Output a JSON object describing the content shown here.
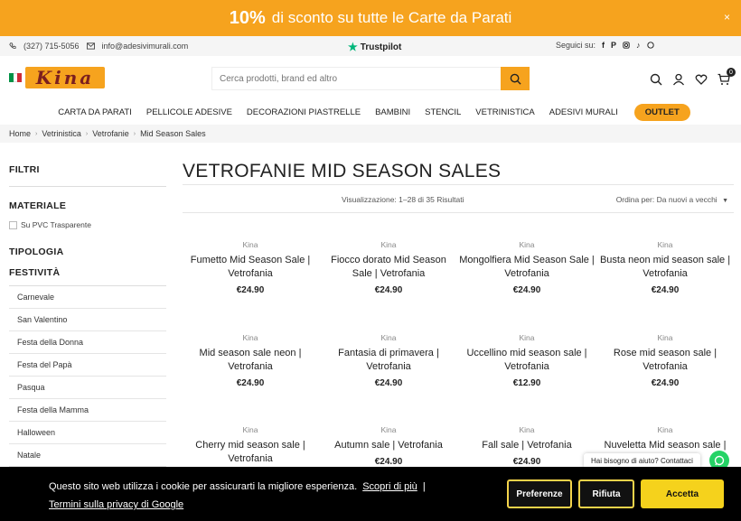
{
  "promo": {
    "percent": "10%",
    "text": "di sconto su tutte le Carte da Parati",
    "close": "×"
  },
  "topbar": {
    "phone": "(327) 715-5056",
    "email": "info@adesivimurali.com",
    "trustpilot": "Trustpilot",
    "social_label": "Seguici su:",
    "social_icons": [
      "facebook-icon",
      "pinterest-icon",
      "instagram-icon",
      "tiktok-icon",
      "whatsapp-icon"
    ]
  },
  "logo": {
    "text": "Kina"
  },
  "search": {
    "placeholder": "Cerca prodotti, brand ed altro"
  },
  "cart": {
    "count": "0"
  },
  "nav": [
    "CARTA DA PARATI",
    "PELLICOLE ADESIVE",
    "DECORAZIONI PIASTRELLE",
    "BAMBINI",
    "STENCIL",
    "VETRINISTICA",
    "ADESIVI MURALI"
  ],
  "nav_outlet": "OUTLET",
  "breadcrumb": [
    "Home",
    "Vetrinistica",
    "Vetrofanie",
    "Mid Season Sales"
  ],
  "sidebar": {
    "filters": "FILTRI",
    "materiale": "MATERIALE",
    "materiale_option": "Su PVC Trasparente",
    "tipologia": "TIPOLOGIA",
    "festivita": "FESTIVITÀ",
    "festivita_items": [
      "Carnevale",
      "San Valentino",
      "Festa della Donna",
      "Festa del Papà",
      "Pasqua",
      "Festa della Mamma",
      "Halloween",
      "Natale"
    ]
  },
  "main": {
    "title": "VETROFANIE MID SEASON SALES",
    "results": "Visualizzazione: 1–28 di 35 Risultati",
    "order_label": "Ordina per:",
    "order_value": "Da nuovi a vecchi"
  },
  "products": [
    {
      "brand": "Kina",
      "name": "Fumetto Mid Season Sale | Vetrofania",
      "price": "€24.90"
    },
    {
      "brand": "Kina",
      "name": "Fiocco dorato Mid Season Sale | Vetrofania",
      "price": "€24.90"
    },
    {
      "brand": "Kina",
      "name": "Mongolfiera Mid Season Sale | Vetrofania",
      "price": "€24.90"
    },
    {
      "brand": "Kina",
      "name": "Busta neon mid season sale | Vetrofania",
      "price": "€24.90"
    },
    {
      "brand": "Kina",
      "name": "Mid season sale neon | Vetrofania",
      "price": "€24.90"
    },
    {
      "brand": "Kina",
      "name": "Fantasia di primavera | Vetrofania",
      "price": "€24.90"
    },
    {
      "brand": "Kina",
      "name": "Uccellino mid season sale | Vetrofania",
      "price": "€12.90"
    },
    {
      "brand": "Kina",
      "name": "Rose mid season sale | Vetrofania",
      "price": "€24.90"
    },
    {
      "brand": "Kina",
      "name": "Cherry mid season sale | Vetrofania",
      "price": ""
    },
    {
      "brand": "Kina",
      "name": "Autumn sale | Vetrofania",
      "price": "€24.90"
    },
    {
      "brand": "Kina",
      "name": "Fall sale | Vetrofania",
      "price": "€24.90"
    },
    {
      "brand": "Kina",
      "name": "Nuveletta Mid season sale |",
      "price": ""
    }
  ],
  "cookie": {
    "text": "Questo sito web utilizza i cookie per assicurarti la migliore esperienza.",
    "more": "Scopri di più",
    "sep": "|",
    "privacy": "Termini sulla privacy di Google",
    "pref": "Preferenze",
    "refuse": "Rifiuta",
    "accept": "Accetta"
  },
  "chat": {
    "text": "Hai bisogno di aiuto? Contattaci"
  },
  "colors": {
    "accent": "#f6a31e",
    "accept": "#f5d21c",
    "whatsapp": "#25d366"
  }
}
